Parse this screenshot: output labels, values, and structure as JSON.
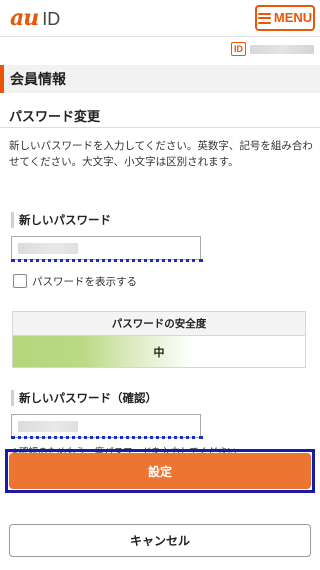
{
  "header": {
    "logo_au": "au",
    "logo_id": "ID",
    "menu_label": "MENU",
    "accent_color": "#eb5505"
  },
  "account": {
    "id_badge": "ID"
  },
  "section": {
    "title": "会員情報"
  },
  "page": {
    "subtitle": "パスワード変更",
    "description": "新しいパスワードを入力してください。英数字、記号を組み合わせてください。大文字、小文字は区別されます。"
  },
  "form": {
    "new_password_label": "新しいパスワード",
    "show_password_label": "パスワードを表示する",
    "strength_title": "パスワードの安全度",
    "strength_level": "中",
    "confirm_label": "新しいパスワード（確認）",
    "confirm_note": "※確認のためもう一度パスワードを入力してください"
  },
  "actions": {
    "submit_label": "設定",
    "submit_color": "#ec7532",
    "cancel_label": "キャンセル"
  }
}
